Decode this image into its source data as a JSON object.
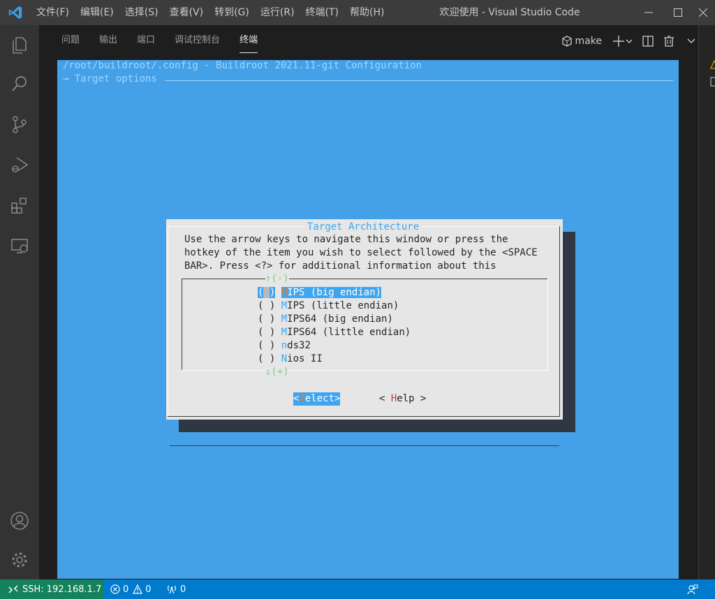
{
  "titlebar": {
    "menu": [
      "文件(F)",
      "编辑(E)",
      "选择(S)",
      "查看(V)",
      "转到(G)",
      "运行(R)",
      "终端(T)",
      "帮助(H)"
    ],
    "title": "欢迎使用 - Visual Studio Code"
  },
  "activitybar": {
    "icons": [
      "explorer-icon",
      "search-icon",
      "source-control-icon",
      "run-debug-icon",
      "extensions-icon",
      "remote-explorer-icon",
      "account-icon",
      "settings-gear-icon"
    ]
  },
  "panel": {
    "tabs": [
      {
        "label": "问题",
        "active": false
      },
      {
        "label": "输出",
        "active": false
      },
      {
        "label": "端口",
        "active": false
      },
      {
        "label": "调试控制台",
        "active": false
      },
      {
        "label": "终端",
        "active": true
      }
    ],
    "terminal_name": "make"
  },
  "terminal": {
    "config_path": "/root/buildroot/.config - Buildroot 2021.11-git Configuration",
    "breadcrumb": "→ Target options ",
    "dialog": {
      "title": "Target Architecture",
      "help_lines": [
        "Use the arrow keys to navigate this window or press the",
        "hotkey of the item you wish to select followed by the <SPACE",
        "BAR>. Press <?> for additional information about this"
      ],
      "scroll_up": "↑(-)",
      "scroll_down": "↓(+)",
      "options": [
        {
          "radio": "( )",
          "hotkey": "M",
          "rest": "IPS (big endian)",
          "selected": true
        },
        {
          "radio": "( )",
          "hotkey": "M",
          "rest": "IPS (little endian)",
          "selected": false
        },
        {
          "radio": "( )",
          "hotkey": "M",
          "rest": "IPS64 (big endian)",
          "selected": false
        },
        {
          "radio": "( )",
          "hotkey": "M",
          "rest": "IPS64 (little endian)",
          "selected": false
        },
        {
          "radio": "( )",
          "hotkey": "n",
          "rest": "ds32",
          "selected": false
        },
        {
          "radio": "( )",
          "hotkey": "N",
          "rest": "ios II",
          "selected": false
        }
      ],
      "select_button": {
        "open": "<",
        "hotkey": "S",
        "rest": "elect>"
      },
      "help_button": {
        "open": "< ",
        "hotkey": "H",
        "rest": "elp >"
      }
    }
  },
  "statusbar": {
    "remote": "SSH: 192.168.1.7",
    "errors": "0",
    "warnings": "0",
    "ports": "0"
  },
  "colors": {
    "terminal_bg": "#44a1e8",
    "dialog_bg": "#e6e6e6",
    "accent": "#3fa5ef",
    "statusbar": "#007acc",
    "remote": "#16825d"
  }
}
